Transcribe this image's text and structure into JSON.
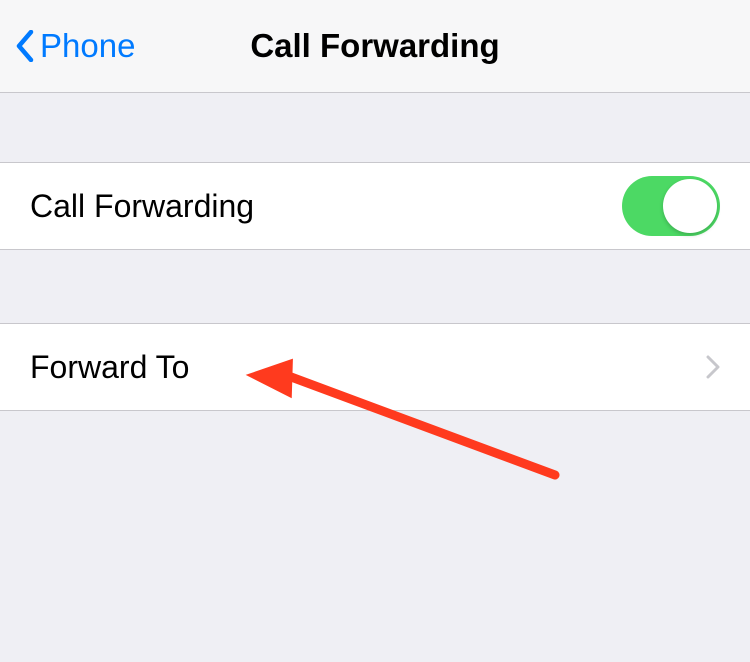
{
  "header": {
    "back_label": "Phone",
    "title": "Call Forwarding"
  },
  "rows": {
    "call_forwarding_label": "Call Forwarding",
    "call_forwarding_enabled": true,
    "forward_to_label": "Forward To"
  }
}
